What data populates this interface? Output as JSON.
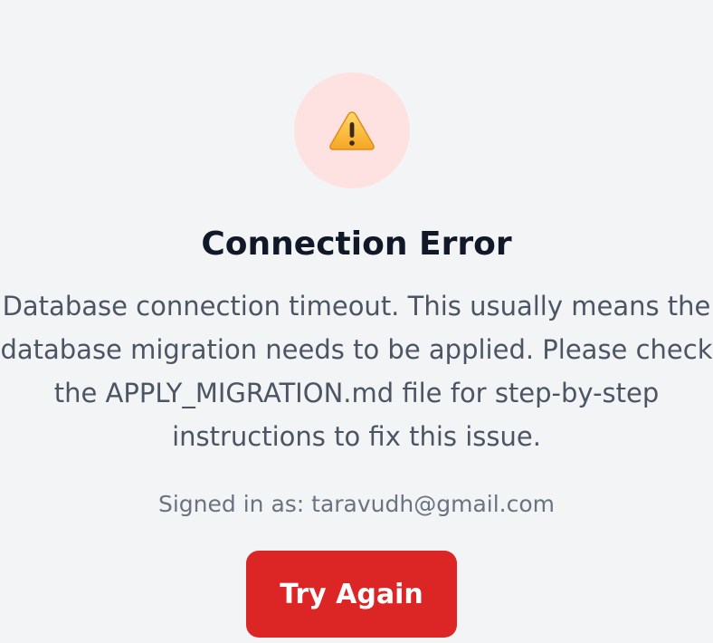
{
  "error": {
    "icon": "warning-icon",
    "title": "Connection Error",
    "message_lines": [
      "Database connection timeout. This usually means the",
      "database migration needs to be applied. Please check",
      "the APPLY_MIGRATION.md file for step-by-step",
      "instructions to fix this issue."
    ],
    "signed_in_text": "Signed in as: taravudh@gmail.com",
    "retry_label": "Try Again"
  },
  "colors": {
    "background": "#f3f4f6",
    "icon_circle": "#fee2e2",
    "button": "#dc2626",
    "title": "#111827",
    "message": "#4b5563"
  }
}
